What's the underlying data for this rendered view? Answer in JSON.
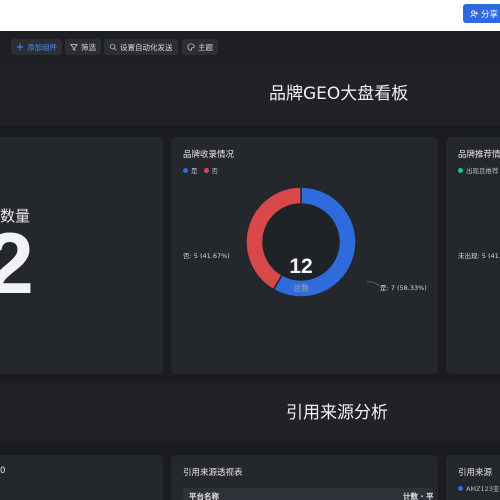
{
  "header": {
    "share_label": "分享"
  },
  "toolbar": {
    "add_widget": "添加组件",
    "filter": "筛选",
    "automation": "设置自动化发送",
    "theme": "主题"
  },
  "sections": [
    {
      "title": "品牌GEO大盘看板"
    },
    {
      "title": "引用来源分析"
    }
  ],
  "cards": {
    "count_card": {
      "title_fragment": "数量",
      "value_fragment": "2"
    },
    "inclusion_card": {
      "title": "品牌收录情况",
      "legend": [
        {
          "label": "是",
          "color": "#2f6bdb"
        },
        {
          "label": "否",
          "color": "#d94848"
        }
      ],
      "center_value": "12",
      "center_label": "总数",
      "labels": {
        "no": "否: 5 (41.67%)",
        "yes": "是: 7 (58.33%)"
      }
    },
    "recommend_card": {
      "title": "品牌推荐情",
      "legend": [
        {
          "label": "出现且推荐",
          "color": "#22c58b"
        }
      ],
      "slice_label": "未出现: 5 (41."
    },
    "source_left_card": {
      "title_fragment": "0"
    },
    "source_view_card": {
      "title": "引用来源透视表",
      "col_platform": "平台名称",
      "col_count": "计数 · 平"
    },
    "source_right_card": {
      "title": "引用来源",
      "legend_item": "AMZ123亚"
    }
  },
  "chart_data": {
    "type": "pie",
    "title": "品牌收录情况",
    "categories": [
      "是",
      "否"
    ],
    "values": [
      7,
      5
    ],
    "percentages": [
      58.33,
      41.67
    ],
    "total": 12,
    "colors": [
      "#2f6bdb",
      "#d94848"
    ],
    "legend_position": "top-left"
  }
}
